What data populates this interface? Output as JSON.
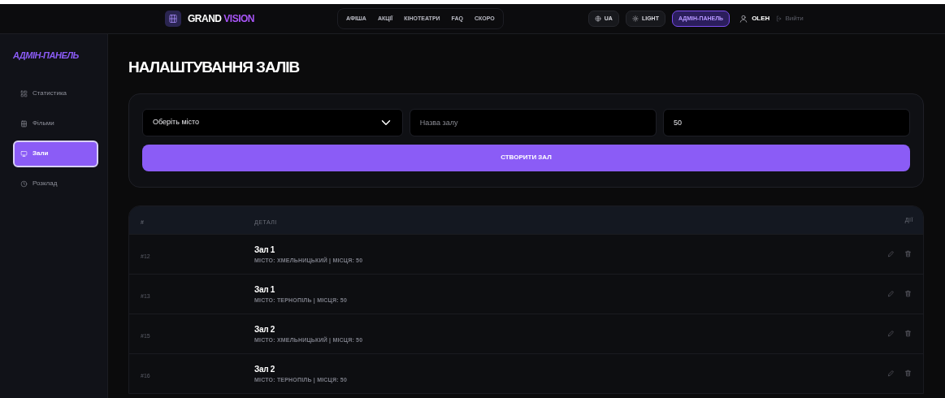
{
  "header": {
    "logo": {
      "word1": "GRAND",
      "word2": "VISION"
    },
    "nav": [
      {
        "label": "АФІША"
      },
      {
        "label": "АКЦІЇ"
      },
      {
        "label": "КІНОТЕАТРИ"
      },
      {
        "label": "FAQ"
      },
      {
        "label": "СКОРО"
      }
    ],
    "language": "UA",
    "theme": "LIGHT",
    "admin_button": "АДМІН-ПАНЕЛЬ",
    "user": "OLEH",
    "logout": "Вийти"
  },
  "sidebar": {
    "title": "АДМІН-ПАНЕЛЬ",
    "items": [
      {
        "label": "Статистика",
        "selected": false
      },
      {
        "label": "Фільми",
        "selected": false
      },
      {
        "label": "Зали",
        "selected": true
      },
      {
        "label": "Розклад",
        "selected": false
      }
    ]
  },
  "page_title": "НАЛАШТУВАННЯ ЗАЛІВ",
  "form": {
    "city_select": "Оберіть місто",
    "name_placeholder": "Назва залу",
    "seats_value": "50",
    "submit": "СТВОРИТИ ЗАЛ"
  },
  "table": {
    "columns": [
      "#",
      "ДЕТАЛІ",
      "ДІЇ"
    ],
    "rows": [
      {
        "id": "#12",
        "name": "Зал 1",
        "details": "МІСТО: ХМЕЛЬНИЦЬКИЙ | МІСЦЯ: 50"
      },
      {
        "id": "#13",
        "name": "Зал 1",
        "details": "МІСТО: ТЕРНОПІЛЬ | МІСЦЯ: 50"
      },
      {
        "id": "#15",
        "name": "Зал 2",
        "details": "МІСТО: ХМЕЛЬНИЦЬКИЙ | МІСЦЯ: 50"
      },
      {
        "id": "#16",
        "name": "Зал 2",
        "details": "МІСТО: ТЕРНОПІЛЬ | МІСЦЯ: 50"
      }
    ]
  }
}
